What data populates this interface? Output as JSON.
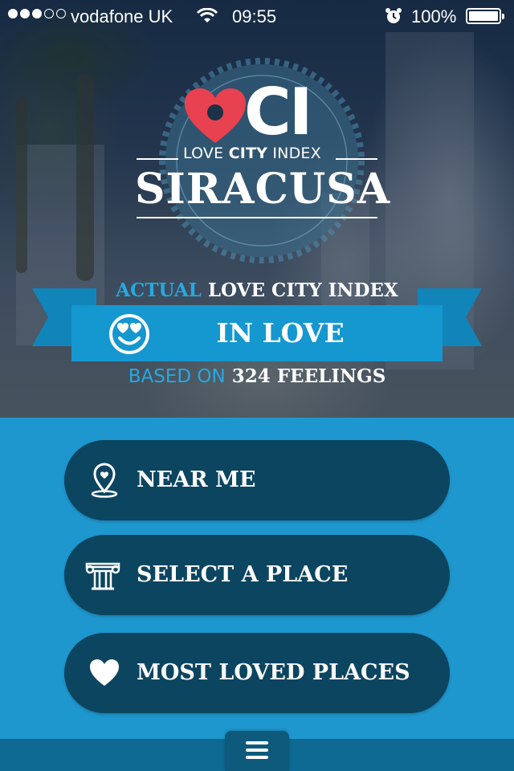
{
  "status_bar": {
    "signal_dots": [
      true,
      true,
      true,
      false,
      false
    ],
    "carrier": "vodafone UK",
    "time": "09:55",
    "battery": "100%",
    "icons": [
      "wifi-icon",
      "alarm-icon",
      "battery-icon"
    ]
  },
  "logo": {
    "mark_text": "CI",
    "subtitle_pre": "LOVE ",
    "subtitle_bold": "CITY",
    "subtitle_post": " INDEX",
    "city": "SIRACUSA",
    "heart_color": "#e8414f"
  },
  "love_index": {
    "label_accent": "ACTUAL",
    "label_rest": " LOVE CITY INDEX",
    "status": "IN LOVE",
    "status_icon": "heart-eyes-smiley-icon",
    "based_on_label": "BASED ON",
    "feelings_count": "324 FEELINGS"
  },
  "menu": [
    {
      "label": "NEAR ME",
      "icon": "map-pin-heart-icon"
    },
    {
      "label": "SELECT A PLACE",
      "icon": "column-icon"
    },
    {
      "label": "MOST LOVED PLACES",
      "icon": "heart-icon"
    }
  ],
  "bottom_bar": {
    "icon": "hamburger-menu-icon"
  },
  "colors": {
    "accent": "#27a8e0",
    "ribbon": "#1597d0",
    "background": "#1e97ce",
    "button": "#0c4560",
    "heart": "#e8414f"
  }
}
